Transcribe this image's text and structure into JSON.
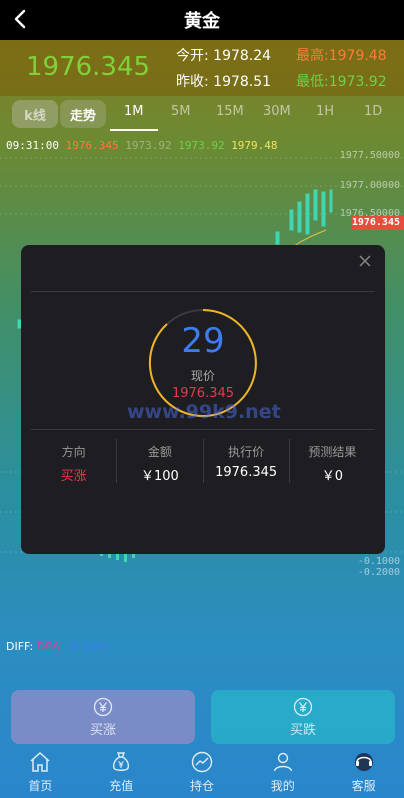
{
  "header": {
    "title": "黄金"
  },
  "quote": {
    "current": "1976.345",
    "open_label": "今开:",
    "open_value": "1978.24",
    "high_label": "最高:",
    "high_value": "1979.48",
    "prev_close_label": "昨收:",
    "prev_close_value": "1978.51",
    "low_label": "最低:",
    "low_value": "1973.92"
  },
  "chart_tabs": {
    "kline_label": "k线",
    "trend_label": "走势",
    "periods": [
      "1M",
      "5M",
      "15M",
      "30M",
      "1H",
      "1D"
    ],
    "active_period": "1M"
  },
  "info_line": {
    "time": "09:31:00",
    "v1": "1976.345",
    "v2": "1973.92",
    "v3": "1973.92",
    "v4": "1979.48"
  },
  "y_axis": {
    "labels": [
      "1977.50000",
      "1977.00000",
      "1976.50000",
      "1976.345"
    ]
  },
  "diff_indicator": {
    "label": "DIFF:",
    "dea": "DEA:",
    "value": "-0.1040"
  },
  "macd_axis": [
    "-0.1000",
    "-0.2000"
  ],
  "modal": {
    "countdown": "29",
    "current_price_label": "现价",
    "current_price": "1976.345",
    "watermark": "www.99k9.net",
    "columns": [
      {
        "label": "方向",
        "value": "买涨"
      },
      {
        "label": "金额",
        "value": "￥100"
      },
      {
        "label": "执行价",
        "value": "1976.345"
      },
      {
        "label": "预测结果",
        "value": "￥0"
      }
    ]
  },
  "actions": {
    "buy_up": "买涨",
    "buy_down": "买跌"
  },
  "nav": [
    {
      "label": "首页",
      "icon": "home-icon"
    },
    {
      "label": "充值",
      "icon": "money-bag-icon"
    },
    {
      "label": "持仓",
      "icon": "chart-icon"
    },
    {
      "label": "我的",
      "icon": "user-icon"
    },
    {
      "label": "客服",
      "icon": "support-icon"
    }
  ],
  "colors": {
    "up": "#e63a4a",
    "price_green": "#7fd13b",
    "accent_blue": "#3d7cf0",
    "ring_gold": "#f0b429"
  }
}
